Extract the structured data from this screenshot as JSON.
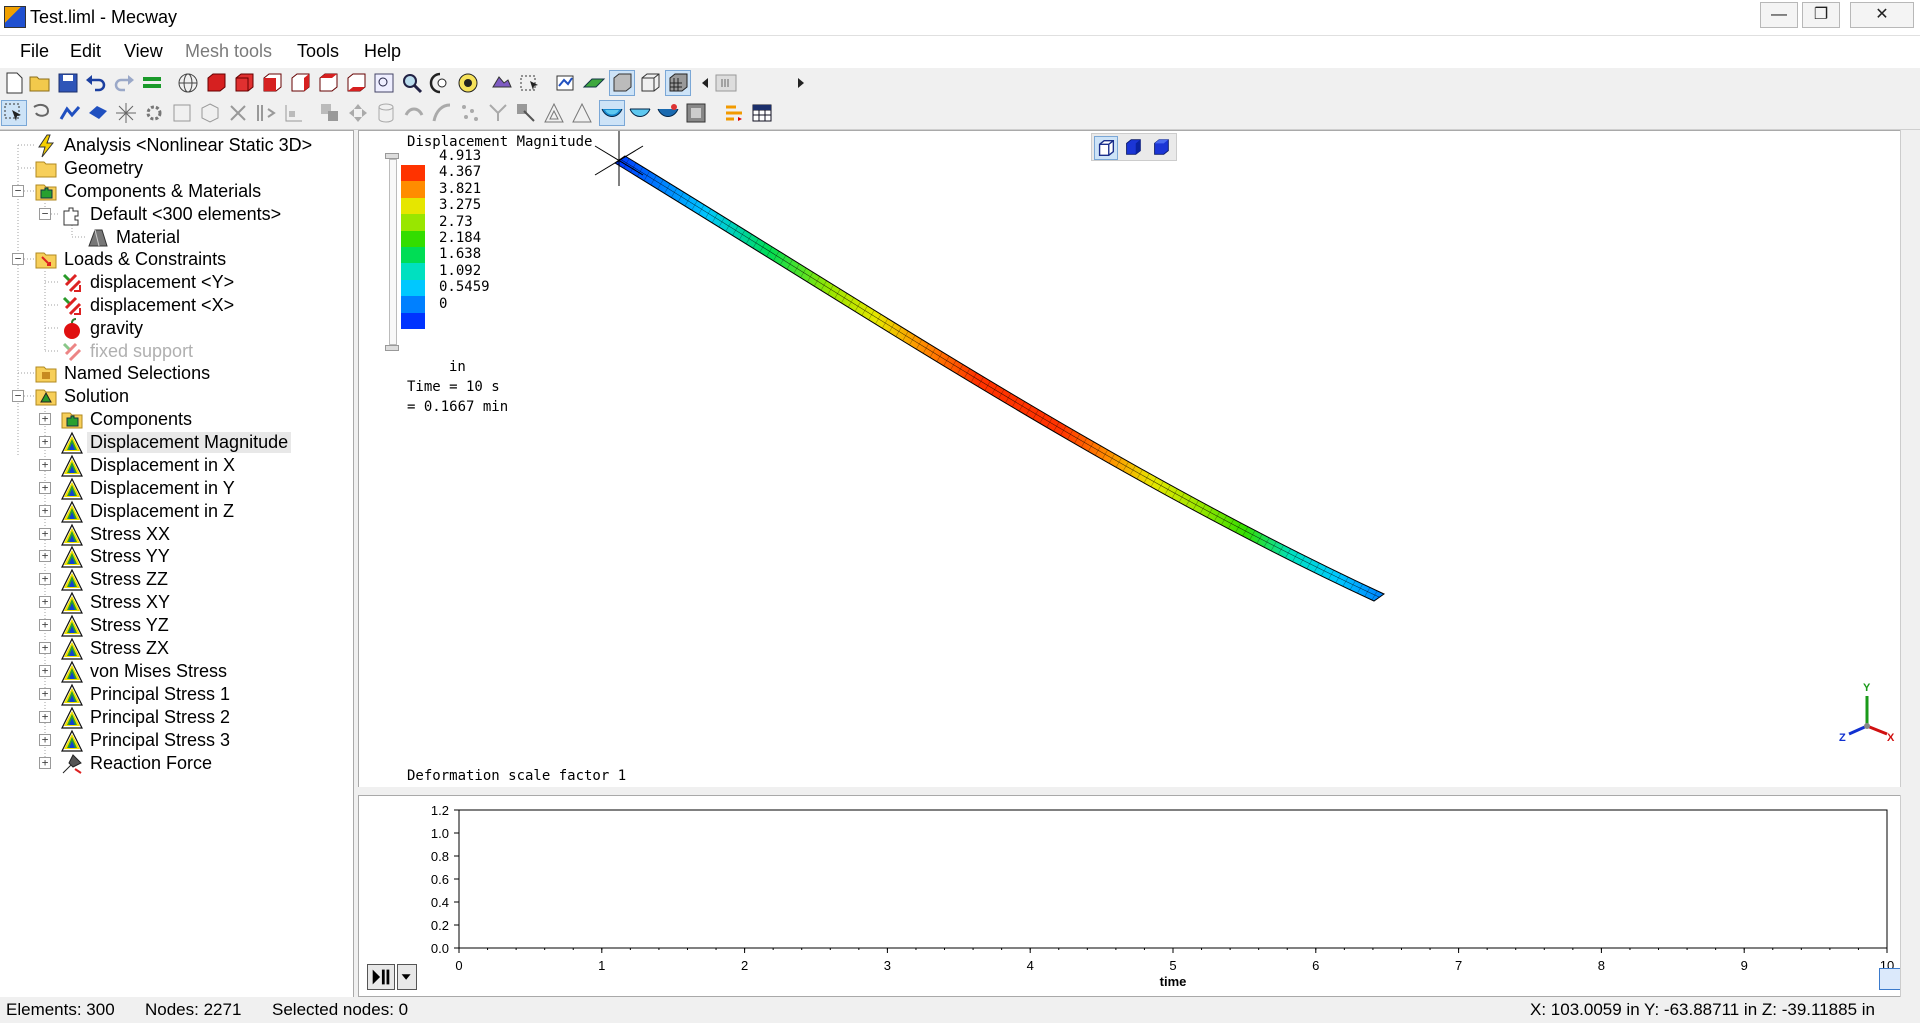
{
  "window": {
    "title": "Test.liml - Mecway",
    "minimize": "—",
    "maximize": "❐",
    "close": "✕"
  },
  "menu": {
    "file": "File",
    "edit": "Edit",
    "view": "View",
    "mesh_tools": "Mesh tools",
    "tools": "Tools",
    "help": "Help"
  },
  "tree": {
    "analysis": "Analysis <Nonlinear Static 3D>",
    "geometry": "Geometry",
    "components_materials": "Components & Materials",
    "default": "Default <300 elements>",
    "material": "Material",
    "loads_constraints": "Loads & Constraints",
    "displacement_y": "displacement <Y>",
    "displacement_x": "displacement <X>",
    "gravity": "gravity",
    "fixed_support": "fixed support",
    "named_selections": "Named Selections",
    "solution": "Solution",
    "solution_items": [
      "Components",
      "Displacement Magnitude",
      "Displacement in X",
      "Displacement in Y",
      "Displacement in Z",
      "Stress XX",
      "Stress YY",
      "Stress ZZ",
      "Stress XY",
      "Stress YZ",
      "Stress ZX",
      "von Mises Stress",
      "Principal Stress 1",
      "Principal Stress 2",
      "Principal Stress 3",
      "Reaction Force"
    ]
  },
  "viewport": {
    "legend_title": "Displacement Magnitude",
    "legend_values": [
      "4.913",
      "4.367",
      "3.821",
      "3.275",
      "2.73",
      "2.184",
      "1.638",
      "1.092",
      "0.5459",
      "0"
    ],
    "legend_colors": [
      "#ff3300",
      "#ff8c00",
      "#e6e600",
      "#99e600",
      "#33dd00",
      "#00dd55",
      "#00e0c0",
      "#00c8ff",
      "#0080ff",
      "#0033ff"
    ],
    "unit": "in",
    "time_line1": "Time = 10 s",
    "time_line2": "= 0.1667 min",
    "deformation": "Deformation scale factor 1",
    "axis_y": "Y",
    "axis_x": "X",
    "axis_z": "Z"
  },
  "chart_data": {
    "type": "line",
    "title": "",
    "xlabel": "time",
    "ylabel": "",
    "xlim": [
      0,
      10
    ],
    "ylim": [
      0.0,
      1.2
    ],
    "x_ticks": [
      "0",
      "1",
      "2",
      "3",
      "4",
      "5",
      "6",
      "7",
      "8",
      "9",
      "10"
    ],
    "y_ticks": [
      "0.0",
      "0.2",
      "0.4",
      "0.6",
      "0.8",
      "1.0",
      "1.2"
    ],
    "series": []
  },
  "status": {
    "elements": "Elements: 300",
    "nodes": "Nodes: 2271",
    "selected": "Selected nodes: 0",
    "coords": "X: 103.0059 in Y: -63.88711 in Z: -39.11885 in"
  }
}
